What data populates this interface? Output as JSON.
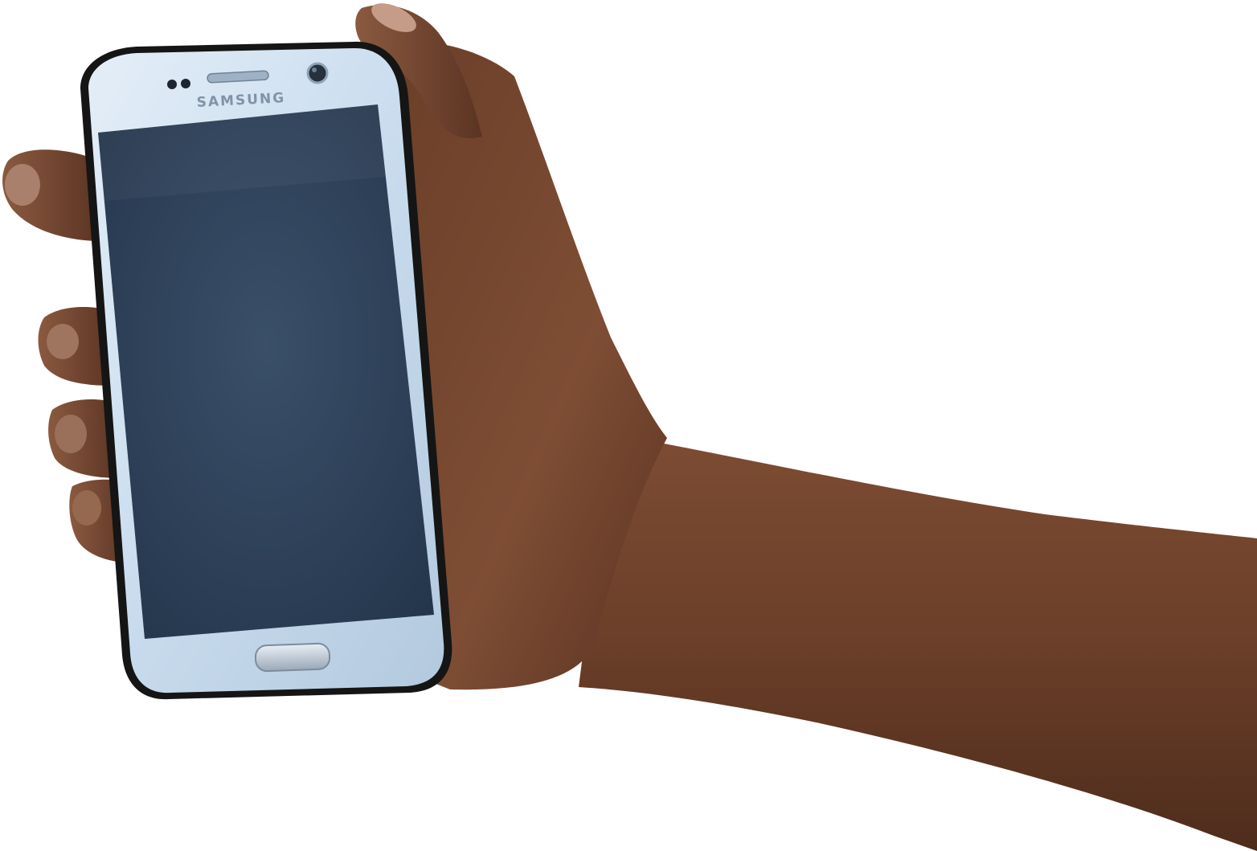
{
  "phone": {
    "brand": "SAMSUNG"
  },
  "colors": {
    "background": "#ffffff",
    "skin_dark": "#5a3422",
    "skin_mid": "#7a4a32",
    "skin_light": "#8f5a3e",
    "phone_body": "#cfe0ef",
    "phone_case": "#1a1a1a",
    "screen": "#2c3f56"
  }
}
